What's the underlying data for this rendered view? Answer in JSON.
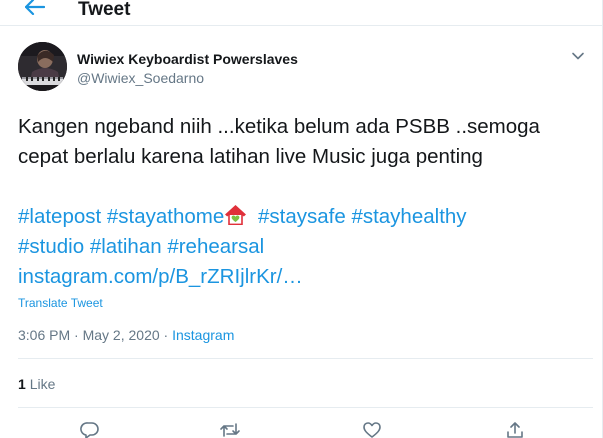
{
  "header": {
    "back_icon": "arrow-left-icon",
    "title": "Tweet"
  },
  "author": {
    "display_name": "Wiwiex Keyboardist Powerslaves",
    "handle": "@Wiwiex_Soedarno"
  },
  "tweet": {
    "line1": "Kangen ngeband niih ...ketika belum ada PSBB ..semoga",
    "line2": "cepat berlalu karena latihan live Music juga penting",
    "hashtags_line1": [
      "#latepost",
      "#stayathome",
      "#staysafe",
      "#stayhealthy"
    ],
    "hashtags_line2": [
      "#studio",
      "#latihan",
      "#rehearsal"
    ],
    "link": "instagram.com/p/B_rZRIjlrKr/…"
  },
  "translate_label": "Translate Tweet",
  "meta": {
    "time": "3:06 PM",
    "separator": " · ",
    "date": "May 2, 2020",
    "source": "Instagram"
  },
  "stats": {
    "likes_count": "1",
    "likes_label": "Like"
  },
  "colors": {
    "link": "#1b95e0",
    "text": "#14171a",
    "muted": "#657786",
    "border": "#e6ecf0"
  },
  "icons": {
    "reply": "reply-icon",
    "retweet": "retweet-icon",
    "like": "heart-icon",
    "share": "share-icon",
    "caret": "chevron-down-icon",
    "emoji": "house-with-heart-emoji"
  }
}
